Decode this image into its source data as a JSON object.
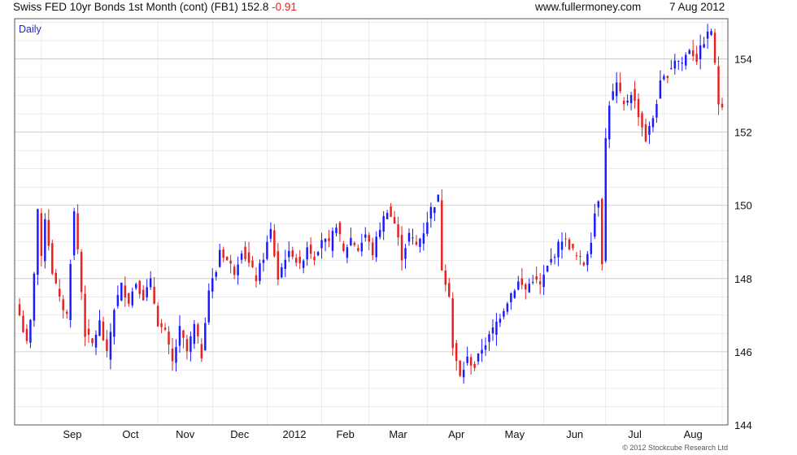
{
  "header": {
    "title": "Swiss FED 10yr Bonds 1st Month (cont) (FB1)",
    "last": "152.8",
    "change": "-0.91",
    "site": "www.fullermoney.com",
    "date": "7 Aug 2012"
  },
  "colors": {
    "up": "#1a1aff",
    "down": "#e8201f",
    "grid": "#d8d8d8",
    "label": "#2626c8"
  },
  "chart_data": {
    "type": "candlestick",
    "period_label": "Daily",
    "copyright": "© 2012 Stockcube Research Ltd",
    "ylim": [
      144,
      155.1
    ],
    "yticks": [
      144,
      146,
      148,
      150,
      152,
      154
    ],
    "y_axis_position": "right",
    "grid": true,
    "x_labels": [
      "Sep",
      "Oct",
      "Nov",
      "Dec",
      "2012",
      "Feb",
      "Mar",
      "Apr",
      "May",
      "Jun",
      "Jul",
      "Aug"
    ],
    "anchors": [
      [
        0,
        147.0
      ],
      [
        2,
        146.2
      ],
      [
        3,
        146.8
      ],
      [
        4,
        148.2
      ],
      [
        5,
        149.9
      ],
      [
        6,
        148.5
      ],
      [
        7,
        149.7
      ],
      [
        9,
        148.2
      ],
      [
        11,
        147.4
      ],
      [
        13,
        147.0
      ],
      [
        14,
        148.5
      ],
      [
        15,
        149.8
      ],
      [
        16,
        148.8
      ],
      [
        18,
        146.5
      ],
      [
        20,
        146.2
      ],
      [
        22,
        146.8
      ],
      [
        24,
        145.9
      ],
      [
        26,
        147.2
      ],
      [
        28,
        147.8
      ],
      [
        30,
        147.4
      ],
      [
        32,
        147.9
      ],
      [
        34,
        147.5
      ],
      [
        36,
        147.9
      ],
      [
        38,
        146.8
      ],
      [
        40,
        146.5
      ],
      [
        42,
        145.7
      ],
      [
        44,
        146.6
      ],
      [
        46,
        146.0
      ],
      [
        48,
        146.7
      ],
      [
        50,
        145.9
      ],
      [
        51,
        146.9
      ],
      [
        52,
        147.7
      ],
      [
        54,
        148.2
      ],
      [
        55,
        148.8
      ],
      [
        57,
        148.5
      ],
      [
        59,
        148.2
      ],
      [
        61,
        148.8
      ],
      [
        63,
        148.4
      ],
      [
        65,
        148.0
      ],
      [
        67,
        148.6
      ],
      [
        69,
        149.3
      ],
      [
        71,
        148.0
      ],
      [
        73,
        148.6
      ],
      [
        75,
        148.7
      ],
      [
        77,
        148.3
      ],
      [
        79,
        148.9
      ],
      [
        81,
        148.6
      ],
      [
        83,
        149.1
      ],
      [
        85,
        148.9
      ],
      [
        87,
        149.5
      ],
      [
        89,
        148.7
      ],
      [
        91,
        149.1
      ],
      [
        93,
        148.8
      ],
      [
        95,
        149.2
      ],
      [
        97,
        148.7
      ],
      [
        99,
        149.4
      ],
      [
        101,
        149.9
      ],
      [
        103,
        149.5
      ],
      [
        105,
        148.6
      ],
      [
        107,
        149.2
      ],
      [
        109,
        148.9
      ],
      [
        111,
        149.3
      ],
      [
        113,
        149.9
      ],
      [
        115,
        150.2
      ],
      [
        116,
        148.3
      ],
      [
        118,
        147.6
      ],
      [
        119,
        146.1
      ],
      [
        121,
        145.3
      ],
      [
        123,
        145.8
      ],
      [
        125,
        145.6
      ],
      [
        127,
        146.1
      ],
      [
        129,
        146.4
      ],
      [
        131,
        146.8
      ],
      [
        133,
        147.2
      ],
      [
        135,
        147.6
      ],
      [
        137,
        147.9
      ],
      [
        139,
        147.7
      ],
      [
        141,
        148.0
      ],
      [
        143,
        147.8
      ],
      [
        145,
        148.3
      ],
      [
        147,
        148.7
      ],
      [
        149,
        149.1
      ],
      [
        151,
        148.9
      ],
      [
        153,
        148.6
      ],
      [
        155,
        148.4
      ],
      [
        157,
        149.1
      ],
      [
        158,
        149.8
      ],
      [
        159,
        150.2
      ],
      [
        160,
        148.5
      ],
      [
        161,
        151.8
      ],
      [
        162,
        152.8
      ],
      [
        164,
        153.3
      ],
      [
        166,
        152.7
      ],
      [
        168,
        153.1
      ],
      [
        170,
        152.5
      ],
      [
        172,
        151.8
      ],
      [
        174,
        152.4
      ],
      [
        176,
        153.3
      ],
      [
        178,
        153.6
      ],
      [
        180,
        154.0
      ],
      [
        182,
        153.9
      ],
      [
        184,
        154.3
      ],
      [
        186,
        154.0
      ],
      [
        188,
        154.5
      ],
      [
        190,
        154.8
      ],
      [
        191,
        153.8
      ],
      [
        192,
        152.8
      ]
    ],
    "month_starts": [
      6,
      23,
      38,
      53,
      68,
      83,
      96,
      112,
      128,
      144,
      161,
      177,
      193
    ]
  }
}
